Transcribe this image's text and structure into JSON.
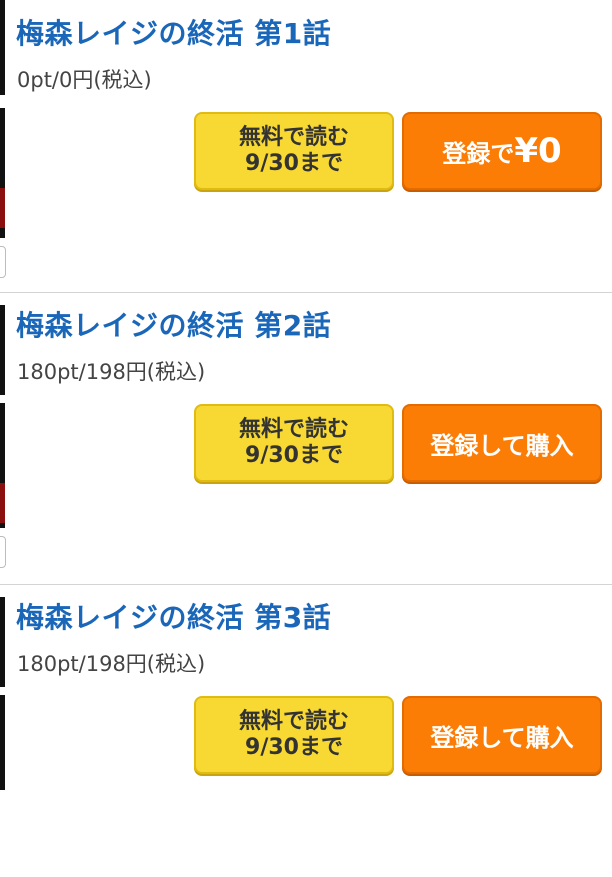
{
  "episodes": [
    {
      "title": "梅森レイジの終活 第1話",
      "price": "0pt/0円(税込)",
      "free_line1": "無料で読む",
      "free_line2": "9/30まで",
      "register_prefix": "登録で",
      "register_amount": "¥0"
    },
    {
      "title": "梅森レイジの終活 第2話",
      "price": "180pt/198円(税込)",
      "free_line1": "無料で読む",
      "free_line2": "9/30まで",
      "register_label": "登録して購入"
    },
    {
      "title": "梅森レイジの終活 第3話",
      "price": "180pt/198円(税込)",
      "free_line1": "無料で読む",
      "free_line2": "9/30まで",
      "register_label": "登録して購入"
    }
  ],
  "colors": {
    "title": "#1a66b8",
    "free_button": "#f8d933",
    "register_button": "#fb7d06"
  }
}
